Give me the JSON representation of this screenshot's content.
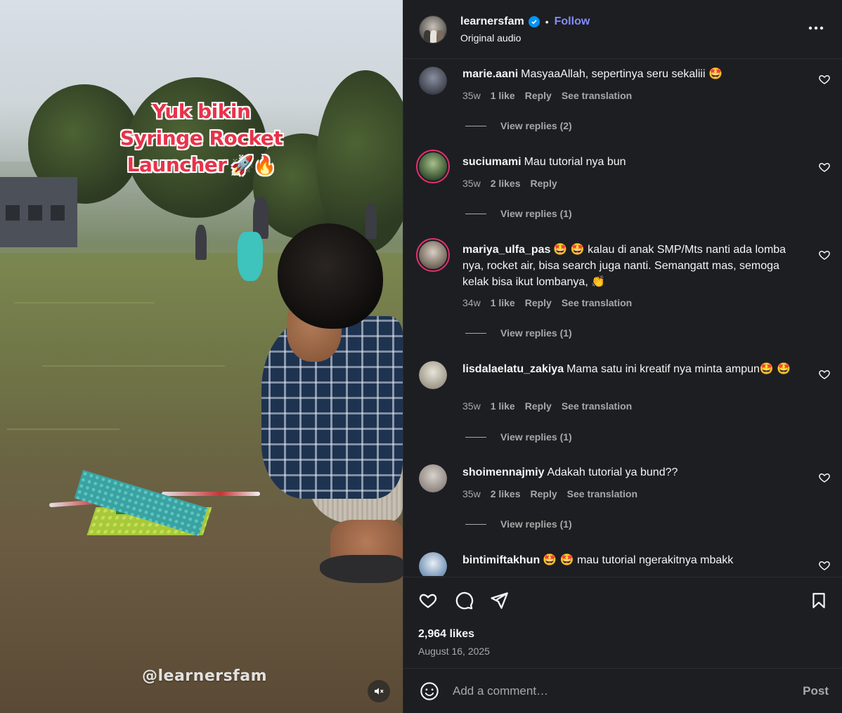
{
  "video": {
    "caption_lines": [
      "Yuk bikin",
      "Syringe Rocket",
      "Launcher"
    ],
    "caption_emojis": "🚀🔥",
    "watermark": "@learnersfam",
    "mute_icon": "speaker-muted-icon"
  },
  "header": {
    "username": "learnersfam",
    "verified_icon": "verified-badge-icon",
    "separator": "•",
    "follow_label": "Follow",
    "audio_label": "Original audio",
    "more_icon": "more-options-icon"
  },
  "comments": [
    {
      "username": "marie.aani",
      "text": "MasyaaAllah, sepertinya seru sekaliii 🤩",
      "time": "35w",
      "likes": "1 like",
      "reply_label": "Reply",
      "translation_label": "See translation",
      "view_replies": "View replies (2)",
      "avatar_color": "#5a5f6e",
      "story_ring": false
    },
    {
      "username": "suciumami",
      "text": "Mau tutorial nya bun",
      "time": "35w",
      "likes": "2 likes",
      "reply_label": "Reply",
      "translation_label": "",
      "view_replies": "View replies (1)",
      "avatar_color": "#4f7a4a",
      "story_ring": true
    },
    {
      "username": "mariya_ulfa_pas",
      "text": "🤩 🤩 kalau di anak SMP/Mts nanti ada lomba nya, rocket air, bisa search juga nanti. Semangatt mas, semoga kelak bisa ikut lombanya, 👏",
      "time": "34w",
      "likes": "1 like",
      "reply_label": "Reply",
      "translation_label": "See translation",
      "view_replies": "View replies (1)",
      "avatar_color": "#9a8b7a",
      "story_ring": true
    },
    {
      "username": "lisdalaelatu_zakiya",
      "text": "Mama satu ini kreatif nya minta ampun🤩 🤩",
      "time": "35w",
      "likes": "1 like",
      "reply_label": "Reply",
      "translation_label": "See translation",
      "view_replies": "View replies (1)",
      "avatar_color": "#c9c6b8",
      "story_ring": false
    },
    {
      "username": "shoimennajmiy",
      "text": "Adakah tutorial ya bund??",
      "time": "35w",
      "likes": "2 likes",
      "reply_label": "Reply",
      "translation_label": "See translation",
      "view_replies": "View replies (1)",
      "avatar_color": "#b8b2ad",
      "story_ring": false
    },
    {
      "username": "bintimiftakhun",
      "text": "🤩 🤩  mau tutorial ngerakitnya mbakk",
      "time": "",
      "likes": "",
      "reply_label": "",
      "translation_label": "",
      "view_replies": "",
      "avatar_color": "#8fb3d4",
      "story_ring": false
    }
  ],
  "actions": {
    "like_icon": "heart-icon",
    "comment_icon": "comment-bubble-icon",
    "share_icon": "share-paper-plane-icon",
    "save_icon": "bookmark-icon",
    "likes_count": "2,964 likes",
    "date": "August 16, 2025"
  },
  "comment_box": {
    "emoji_icon": "smiley-icon",
    "placeholder": "Add a comment…",
    "post_label": "Post"
  },
  "colors": {
    "panel_bg": "#1d1e22",
    "follow": "#858cff",
    "verified": "#0095f6",
    "muted_text": "#a8a8a8",
    "caption_red": "#e8334a"
  }
}
